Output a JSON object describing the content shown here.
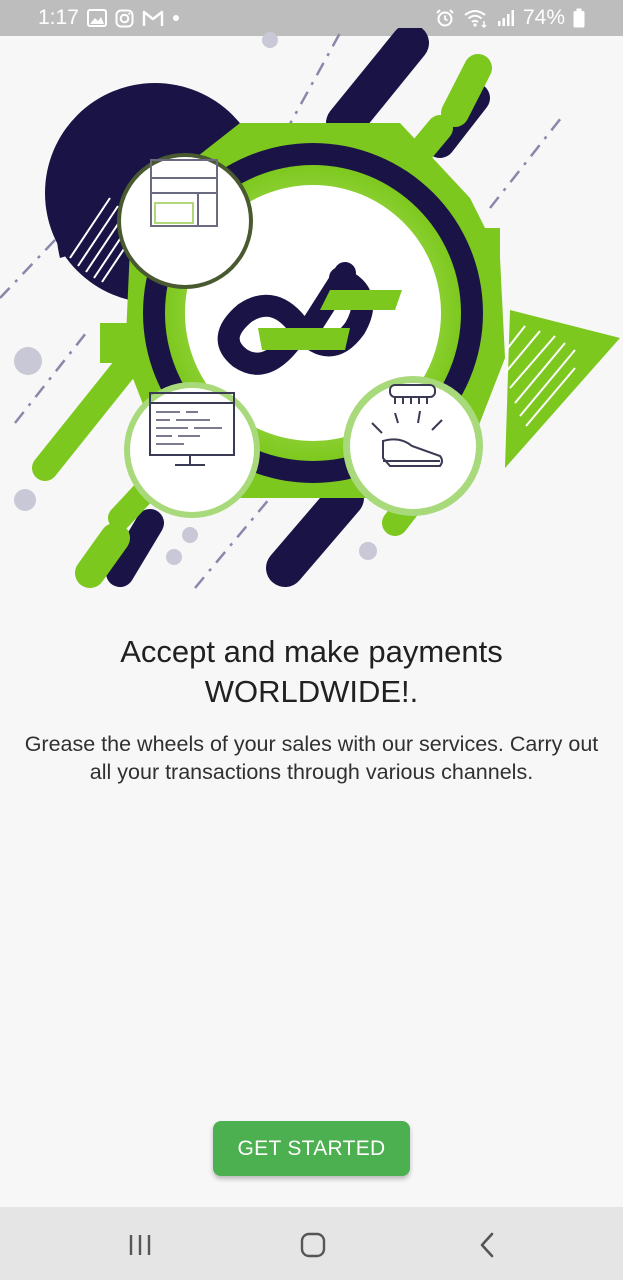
{
  "status_bar": {
    "time": "1:17",
    "battery": "74%",
    "icons_left": [
      "image-icon",
      "instagram-icon",
      "gmail-icon",
      "dot-icon"
    ],
    "icons_right": [
      "alarm-icon",
      "wifi-icon",
      "signal-icon",
      "battery-icon"
    ]
  },
  "illustration": {
    "colors": {
      "navy": "#1a1446",
      "green": "#7dc81e",
      "light_green": "#b4e15a",
      "gray_dot": "#c8c8d6"
    },
    "icons": [
      "storefront-icon",
      "monitor-code-icon",
      "shoe-shine-icon",
      "brand-logo-icon"
    ]
  },
  "content": {
    "headline_line1": "Accept and make payments",
    "headline_line2": "WORLDWIDE!.",
    "description": "Grease the wheels of your sales with our services. Carry out all your transactions through various channels."
  },
  "cta": {
    "label": "GET STARTED",
    "color": "#4caf50"
  },
  "nav_bar": {
    "buttons": [
      "recent-apps-icon",
      "home-icon",
      "back-icon"
    ]
  }
}
